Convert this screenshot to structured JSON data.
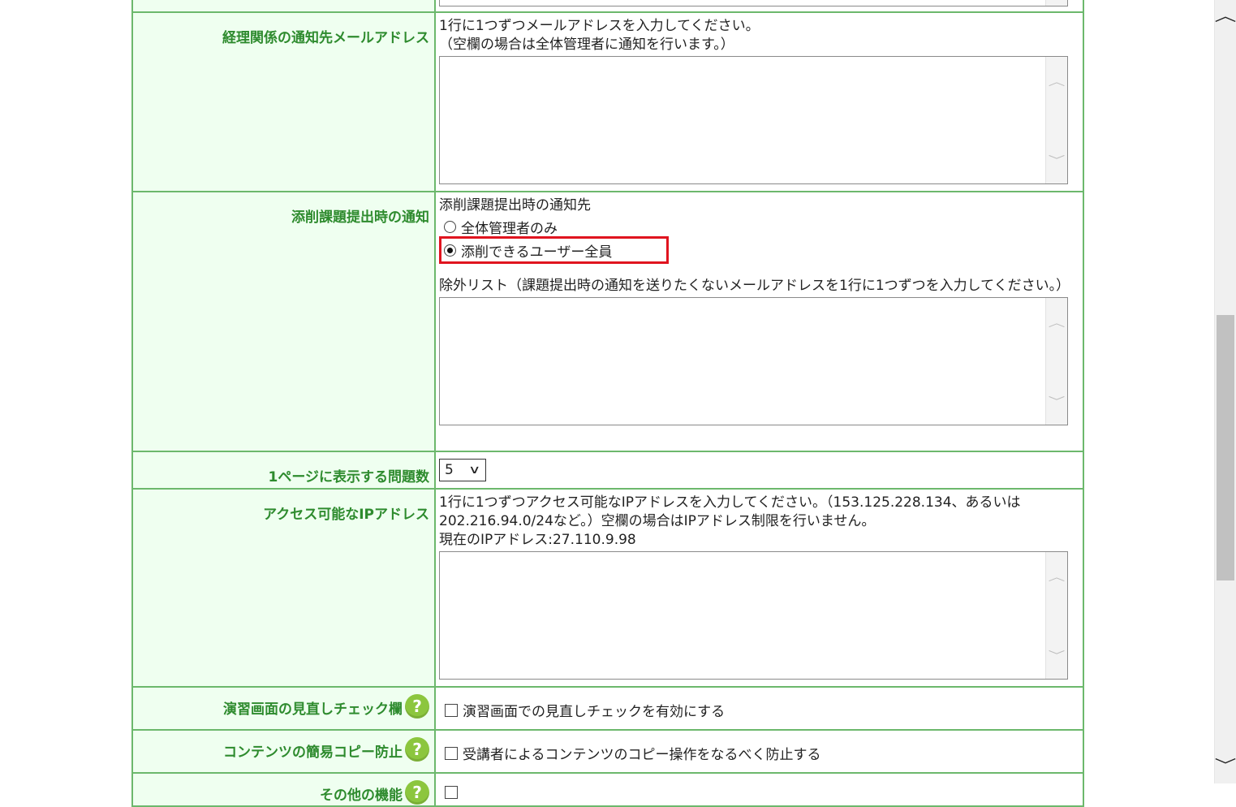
{
  "rows": {
    "accounting": {
      "label": "経理関係の通知先メールアドレス",
      "desc1": "1行に1つずつメールアドレスを入力してください。",
      "desc2": "（空欄の場合は全体管理者に通知を行います。）",
      "value": ""
    },
    "notify": {
      "label": "添削課題提出時の通知",
      "heading": "添削課題提出時の通知先",
      "options": [
        {
          "label": "全体管理者のみ",
          "selected": false
        },
        {
          "label": "添削できるユーザー全員",
          "selected": true
        }
      ],
      "exclude_desc": "除外リスト（課題提出時の通知を送りたくないメールアドレスを1行に1つずつを入力してください。）",
      "value": ""
    },
    "per_page": {
      "label": "1ページに表示する問題数",
      "selected": "5"
    },
    "ip": {
      "label": "アクセス可能なIPアドレス",
      "desc1": "1行に1つずつアクセス可能なIPアドレスを入力してください。（153.125.228.134、あるいは202.216.94.0/24など。）空欄の場合はIPアドレス制限を行いません。",
      "current": "現在のIPアドレス:27.110.9.98",
      "value": ""
    },
    "review_check": {
      "label": "演習画面の見直しチェック欄",
      "checkbox_label": "演習画面での見直しチェックを有効にする",
      "checked": false
    },
    "copy_protect": {
      "label": "コンテンツの簡易コピー防止",
      "checkbox_label": "受講者によるコンテンツのコピー操作をなるべく防止する",
      "checked": false
    },
    "other": {
      "label": "その他の機能"
    }
  },
  "help_glyph": "?",
  "icons": {
    "help": "question-circle-icon",
    "scroll_up": "chevron-up-icon",
    "scroll_down": "chevron-down-icon",
    "select_caret": "chevron-down-icon"
  },
  "colors": {
    "label_text": "#2e8b2e",
    "label_bg": "#effff0",
    "border": "#6cb86c",
    "highlight": "#e0141f",
    "help_bg": "#8cc63e"
  }
}
